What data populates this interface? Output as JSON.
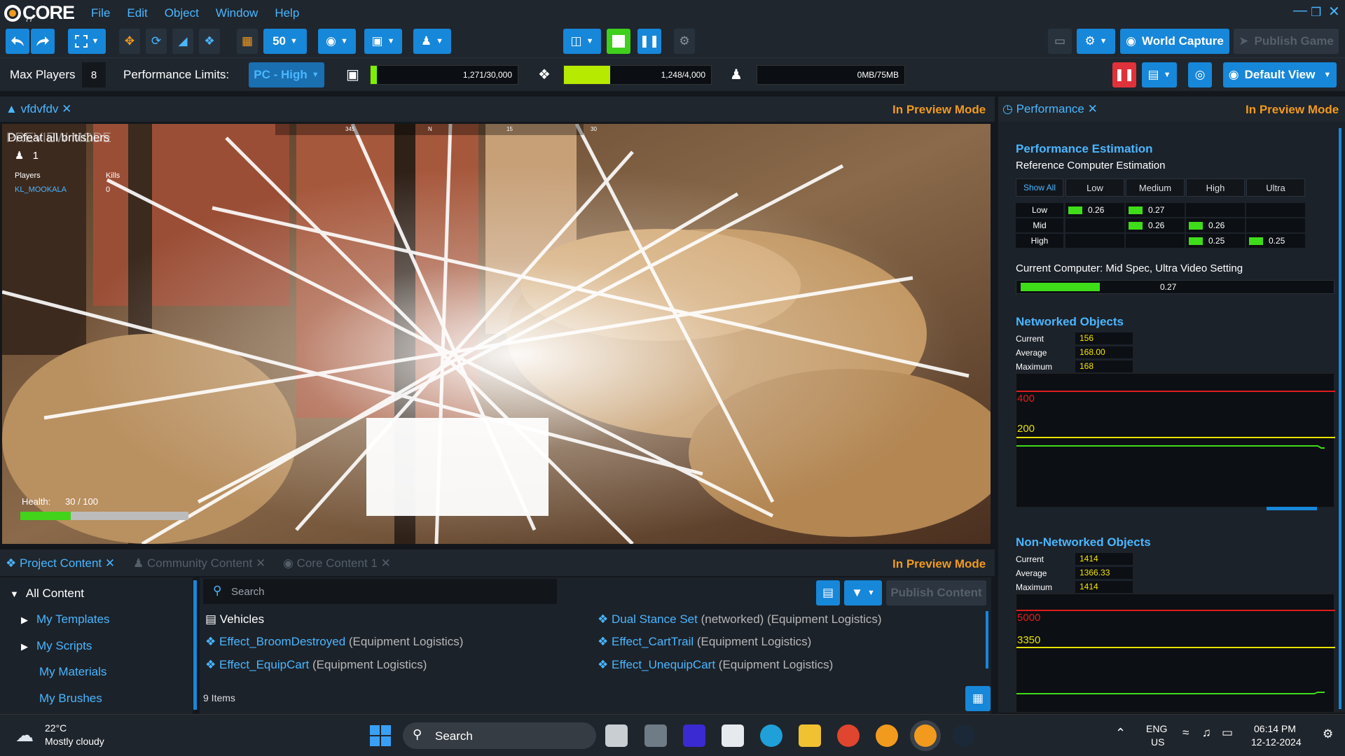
{
  "app": {
    "logo_text": "CORE",
    "logo_sub": "77",
    "menu": [
      "File",
      "Edit",
      "Object",
      "Window",
      "Help"
    ]
  },
  "toolbar": {
    "grid_value": "50",
    "world_capture": "World Capture",
    "publish_game": "Publish Game"
  },
  "limits": {
    "max_players_label": "Max Players",
    "max_players_value": "8",
    "performance_limits_label": "Performance Limits:",
    "performance_limits_value": "PC - High",
    "objects_text": "1,271/30,000",
    "objects_fill": 0.042,
    "networked_text": "1,248/4,000",
    "networked_fill": 0.31,
    "memory_text": "0MB/75MB",
    "memory_fill": 0.0,
    "default_view": "Default View"
  },
  "viewport": {
    "tab_title": "vfdvfdv",
    "preview_mode": "In Preview Mode",
    "objective": "Defeat all britishers",
    "preview_watermark": "PREVIEW MODE",
    "team_count": "1",
    "players_header": "Players",
    "kills_header": "Kills",
    "player_name": "KL_MOOKALA",
    "player_kills": "0",
    "health_label": "Health:",
    "health_value": "30 / 100",
    "health_fill": 0.3,
    "compass": [
      "345",
      "N",
      "15",
      "30"
    ]
  },
  "performance": {
    "tab_title": "Performance",
    "preview_mode": "In Preview Mode",
    "estimation_title": "Performance Estimation",
    "reference_label": "Reference Computer Estimation",
    "show_all": "Show All",
    "columns": [
      "Low",
      "Medium",
      "High",
      "Ultra"
    ],
    "rows": [
      {
        "label": "Low",
        "cells": [
          "0.26",
          "0.27",
          "",
          ""
        ]
      },
      {
        "label": "Mid",
        "cells": [
          "",
          "0.26",
          "0.26",
          ""
        ]
      },
      {
        "label": "High",
        "cells": [
          "",
          "",
          "0.25",
          "0.25"
        ]
      }
    ],
    "current_computer": "Current Computer: Mid Spec, Ultra Video Setting",
    "current_value": "0.27",
    "current_fill": 0.27,
    "networked": {
      "title": "Networked Objects",
      "current_label": "Current",
      "current": "156",
      "average_label": "Average",
      "average": "168.00",
      "maximum_label": "Maximum",
      "maximum": "168",
      "line_high": "400",
      "line_mid": "200"
    },
    "non_networked": {
      "title": "Non-Networked Objects",
      "current_label": "Current",
      "current": "1414",
      "average_label": "Average",
      "average": "1366.33",
      "maximum_label": "Maximum",
      "maximum": "1414",
      "line_high": "5000",
      "line_mid": "3350"
    }
  },
  "content": {
    "tab_project": "Project Content",
    "tab_community": "Community Content",
    "tab_core": "Core Content 1",
    "preview_mode": "In Preview Mode",
    "publish_content": "Publish Content",
    "search_placeholder": "Search",
    "tree": {
      "root": "All Content",
      "items": [
        "My Templates",
        "My Scripts",
        "My Materials",
        "My Brushes"
      ]
    },
    "folder": "Vehicles",
    "files": [
      {
        "name": "Effect_BroomDestroyed",
        "desc": "(Equipment Logistics)"
      },
      {
        "name": "Effect_EquipCart",
        "desc": "(Equipment Logistics)"
      },
      {
        "name": "Dual Stance Set",
        "desc": "(networked) (Equipment Logistics)"
      },
      {
        "name": "Effect_CartTrail",
        "desc": "(Equipment Logistics)"
      },
      {
        "name": "Effect_UnequipCart",
        "desc": "(Equipment Logistics)"
      }
    ],
    "item_count": "9 Items"
  },
  "taskbar": {
    "temperature": "22°C",
    "weather": "Mostly cloudy",
    "search": "Search",
    "lang": "ENG",
    "region": "US",
    "time": "06:14 PM",
    "date": "12-12-2024"
  }
}
